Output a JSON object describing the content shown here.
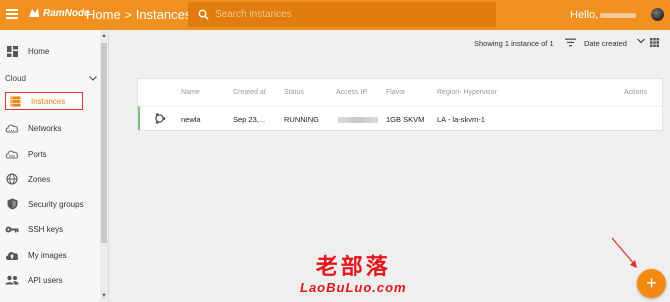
{
  "header": {
    "brand": "RamNode",
    "breadcrumb": [
      "Home",
      "Instances"
    ],
    "breadcrumb_sep": ">",
    "search_placeholder": "Search instances",
    "greeting": "Hello,"
  },
  "sidebar": {
    "home": "Home",
    "section": "Cloud",
    "items": [
      {
        "label": "Instances",
        "icon": "server-icon"
      },
      {
        "label": "Networks",
        "icon": "cloud-network-icon"
      },
      {
        "label": "Ports",
        "icon": "cloud-ports-icon"
      },
      {
        "label": "Zones",
        "icon": "globe-icon"
      },
      {
        "label": "Security groups",
        "icon": "shield-icon"
      },
      {
        "label": "SSH keys",
        "icon": "key-icon"
      },
      {
        "label": "My images",
        "icon": "cloud-upload-icon"
      },
      {
        "label": "API users",
        "icon": "users-icon"
      }
    ]
  },
  "toolbar": {
    "showing": "Showing 1 instance of 1",
    "sort_label": "Date created"
  },
  "table": {
    "columns": [
      "Name",
      "Created at",
      "Status",
      "Access IP",
      "Flavor",
      "Region- Hypervisor",
      "Actions"
    ],
    "rows": [
      {
        "name": "newla",
        "created": "Sep 23,...",
        "status": "RUNNING",
        "flavor": "1GB SKVM",
        "region": "LA - la-skvm-1"
      }
    ]
  },
  "watermark": {
    "cn": "老部落",
    "en": "LaoBuLuo.com"
  },
  "fab_label": "+",
  "colors": {
    "brand": "#f0901e",
    "active": "#e8820c",
    "highlight_border": "#e03030",
    "row_accent": "#7cc47c"
  }
}
